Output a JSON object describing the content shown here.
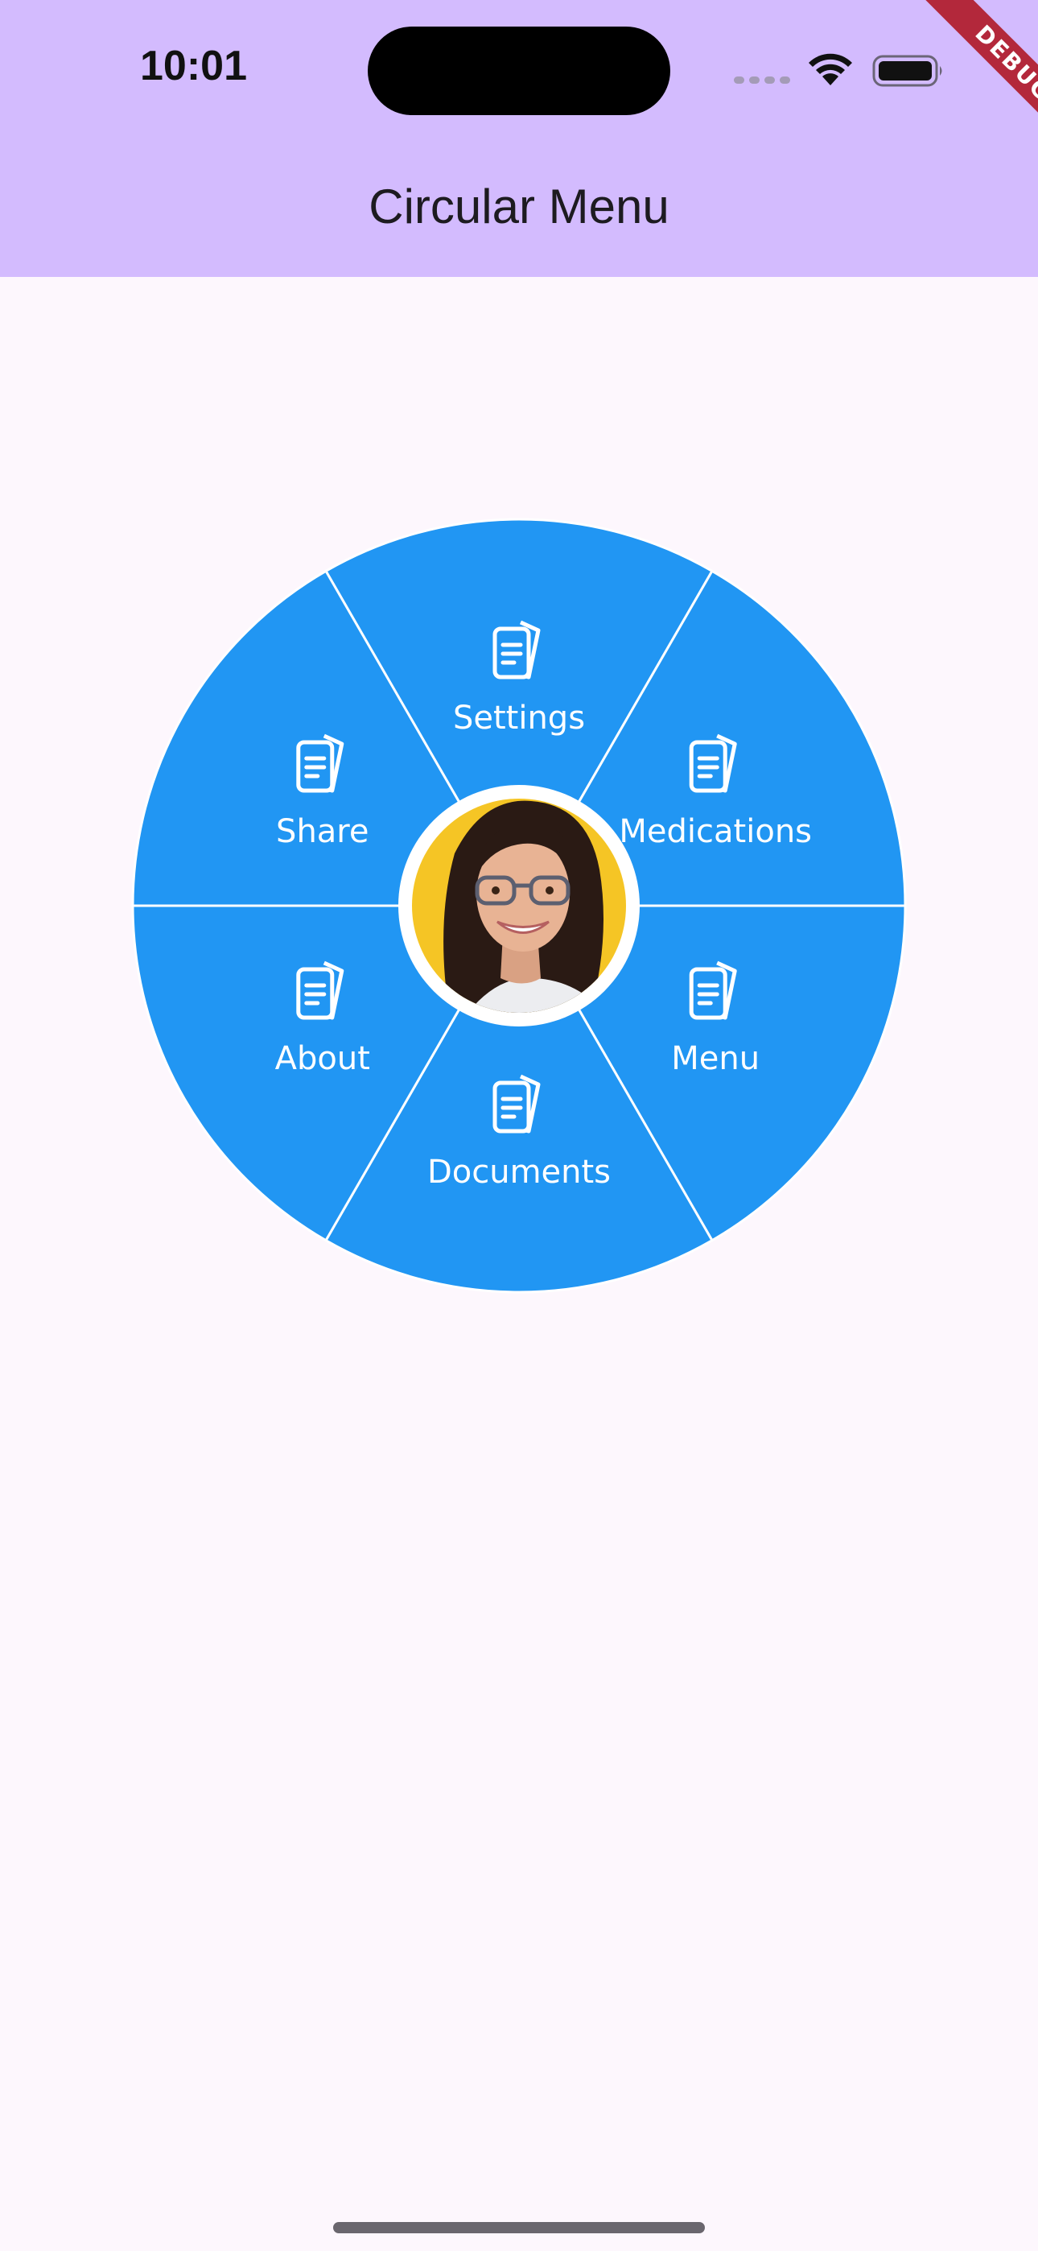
{
  "status_bar": {
    "time": "10:01",
    "icons": [
      "cellular-signal-icon",
      "wifi-icon",
      "battery-icon"
    ]
  },
  "debug_banner": "DEBUG",
  "app_bar": {
    "title": "Circular Menu"
  },
  "menu": {
    "color": "#2196f3",
    "center_avatar": "avatar-photo",
    "items": [
      {
        "label": "Settings",
        "icon": "document-icon"
      },
      {
        "label": "Medications",
        "icon": "document-icon"
      },
      {
        "label": "Menu",
        "icon": "document-icon"
      },
      {
        "label": "Documents",
        "icon": "document-icon"
      },
      {
        "label": "About",
        "icon": "document-icon"
      },
      {
        "label": "Share",
        "icon": "document-icon"
      }
    ]
  },
  "colors": {
    "app_bar": "#d3bbfe",
    "background": "#fdf7fd",
    "menu_blue": "#2196f3",
    "avatar_bg": "#f5c525",
    "debug_ribbon": "#b3283b"
  }
}
